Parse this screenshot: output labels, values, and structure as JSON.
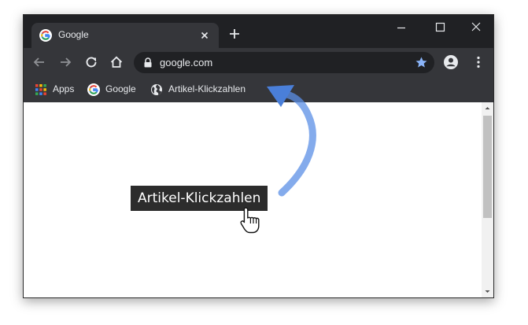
{
  "tab": {
    "title": "Google"
  },
  "omnibox": {
    "url": "google.com"
  },
  "bookmarks": [
    {
      "label": "Apps",
      "icon": "apps-grid-icon"
    },
    {
      "label": "Google",
      "icon": "google-g-icon"
    },
    {
      "label": "Artikel-Klickzahlen",
      "icon": "globe-icon"
    }
  ],
  "callout": {
    "text": "Artikel-Klickzahlen"
  },
  "colors": {
    "tabstrip": "#202124",
    "toolbar": "#35363a",
    "arrow": "#5b8fe6",
    "star": "#8ab4f8"
  }
}
